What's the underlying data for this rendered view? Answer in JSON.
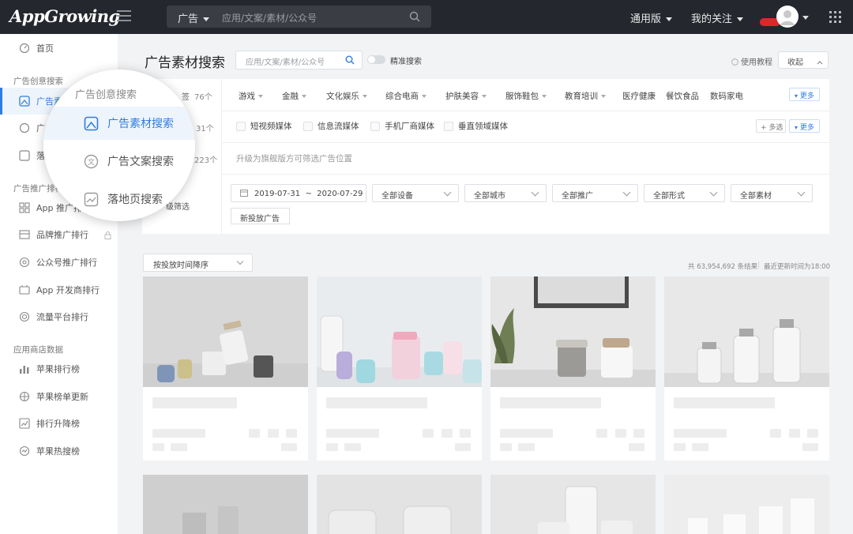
{
  "topbar": {
    "logo": "AppGrowing",
    "search_category": "广告",
    "search_placeholder": "应用/文案/素材/公众号",
    "version_label": "通用版",
    "my_follow_label": "我的关注"
  },
  "sidebar": {
    "home": "首页",
    "group_creative": "广告创意搜索",
    "item_material_partial": "广告素",
    "item_copy_partial": "广",
    "item_landing_partial": "落",
    "group_ranking": "广告推广排行",
    "ranking_items": [
      "App 推广排行",
      "品牌推广排行",
      "公众号推广排行",
      "App 开发商排行",
      "流量平台排行"
    ],
    "group_appstore": "应用商店数据",
    "appstore_items": [
      "苹果排行榜",
      "苹果榜单更新",
      "排行升降榜",
      "苹果热搜榜"
    ]
  },
  "magnifier": {
    "heading": "广告创意搜索",
    "items": [
      "广告素材搜索",
      "广告文案搜索",
      "落地页搜索"
    ]
  },
  "main": {
    "title": "广告素材搜索",
    "search_placeholder": "应用/文案/素材/公众号",
    "exact_search": "精准搜索",
    "tutorial": "使用教程",
    "collapse": "收起",
    "filter_labels_partial": [
      "签",
      "级筛选"
    ],
    "filter_counts_partial": [
      "76个",
      "31个",
      "223个"
    ],
    "categories": [
      {
        "label": "游戏",
        "dropdown": true
      },
      {
        "label": "金融",
        "dropdown": true
      },
      {
        "label": "文化娱乐",
        "dropdown": true
      },
      {
        "label": "综合电商",
        "dropdown": true
      },
      {
        "label": "护肤美容",
        "dropdown": true
      },
      {
        "label": "服饰鞋包",
        "dropdown": true
      },
      {
        "label": "教育培训",
        "dropdown": true
      },
      {
        "label": "医疗健康",
        "dropdown": false
      },
      {
        "label": "餐饮食品",
        "dropdown": false
      },
      {
        "label": "数码家电",
        "dropdown": false
      }
    ],
    "more": "更多",
    "multi_select": "多选",
    "media_types": [
      "短视频媒体",
      "信息流媒体",
      "手机厂商媒体",
      "垂直领域媒体"
    ],
    "upgrade_hint": "升级为旗舰版方可筛选广告位置",
    "date_start": "2019-07-31",
    "date_sep": "~",
    "date_end": "2020-07-29",
    "dropdowns": [
      "全部设备",
      "全部城市",
      "全部推广",
      "全部形式",
      "全部素材"
    ],
    "new_ads_tag": "新投放广告",
    "sort_label": "按投放时间降序",
    "result_count": "共 63,954,692 条结果",
    "last_update": "最近更新时间为18:00"
  },
  "colors": {
    "accent": "#2f7de1",
    "topbar": "#24272d",
    "badge": "#e0262b"
  }
}
